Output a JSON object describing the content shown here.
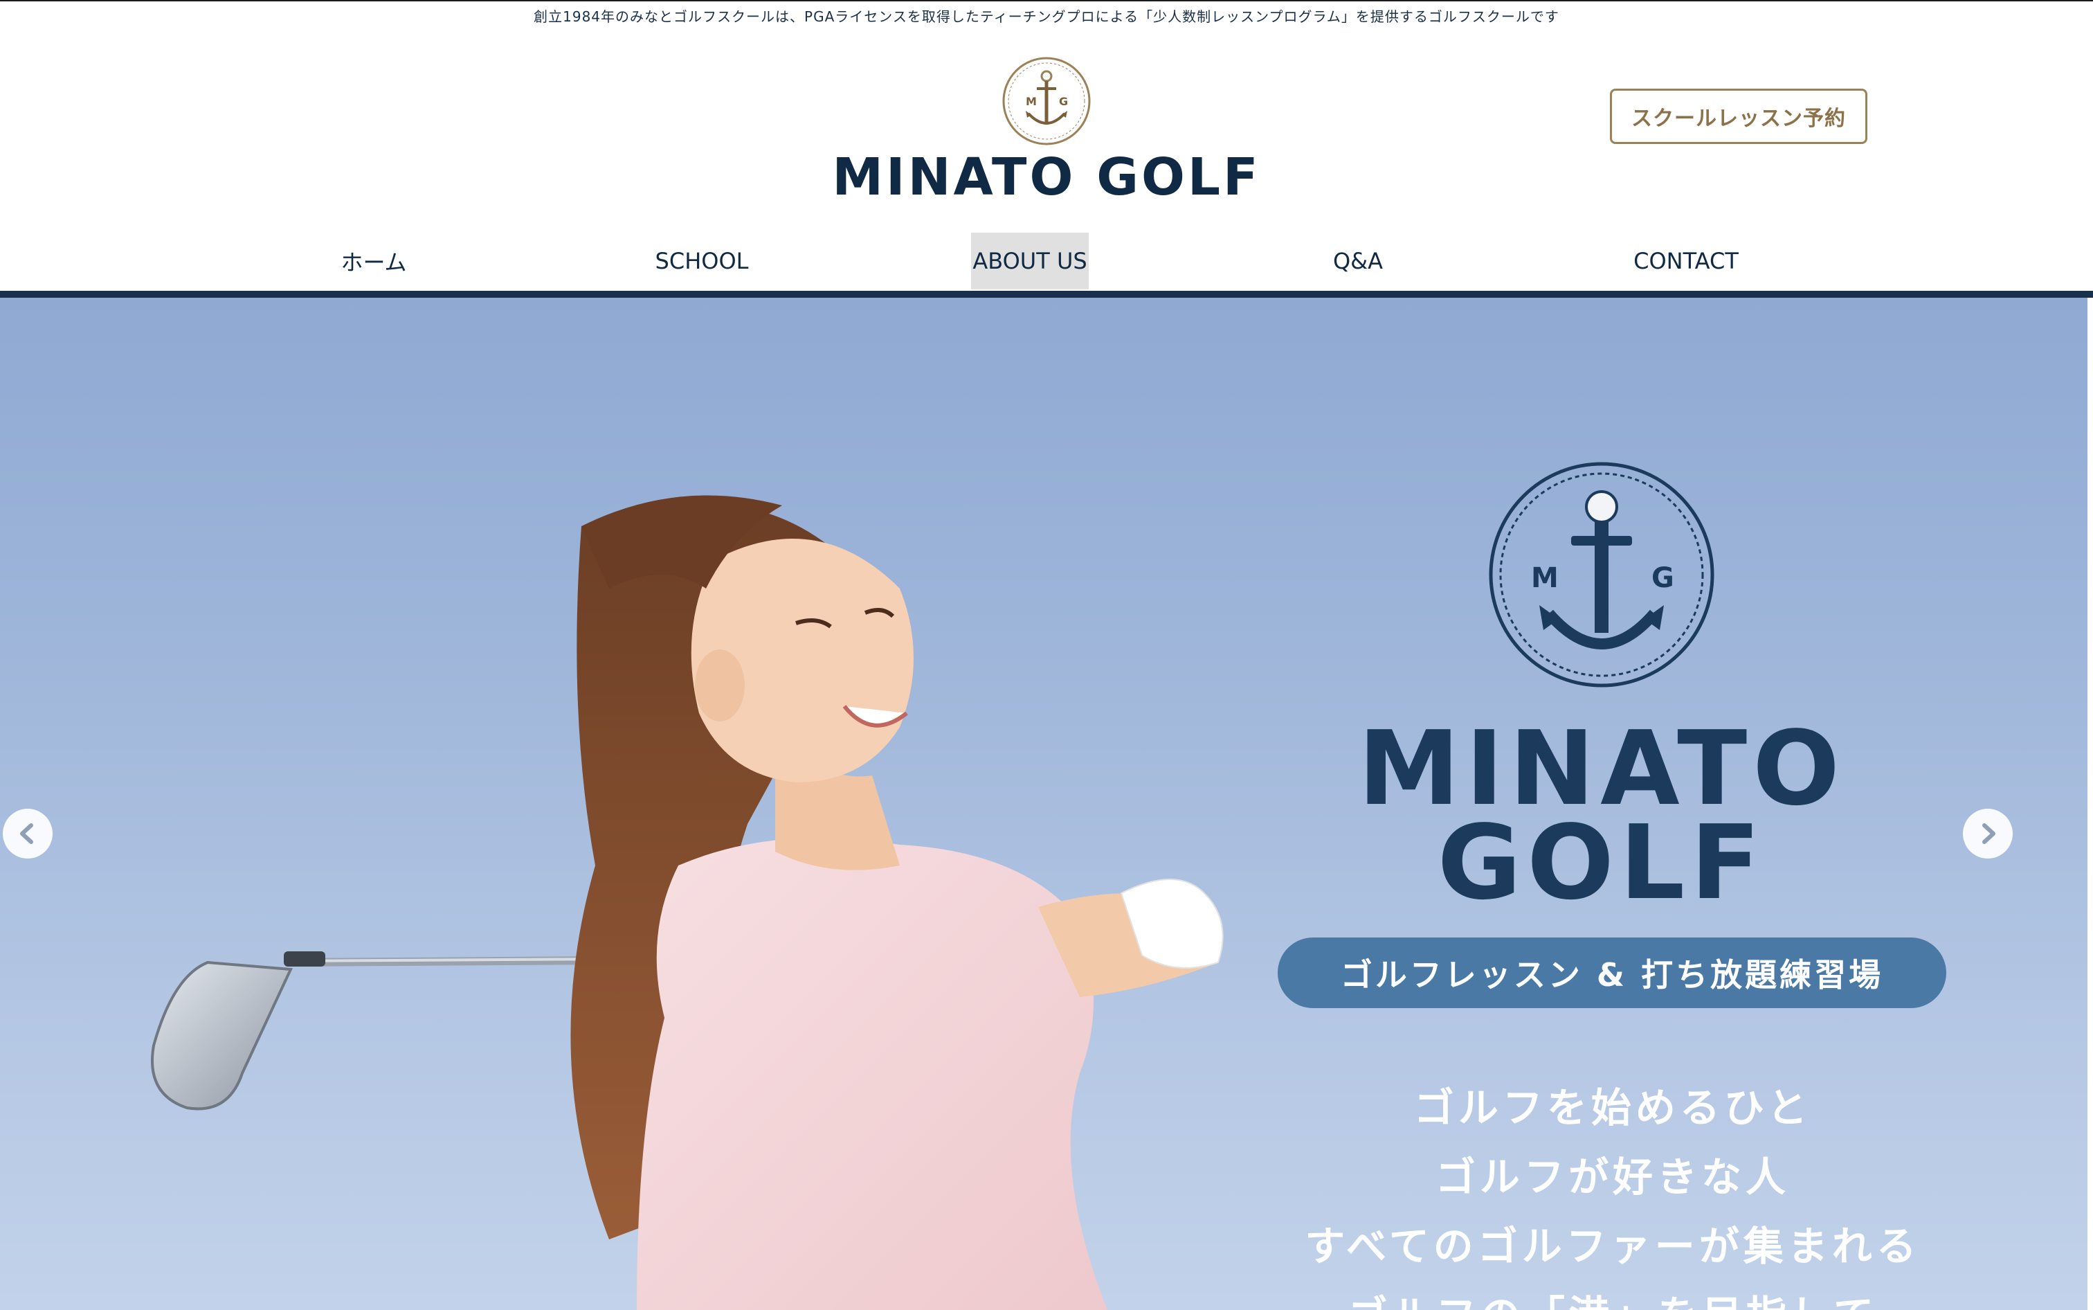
{
  "header": {
    "tagline": "創立1984年のみなとゴルフスクールは、PGAライセンスを取得したティーチングプロによる「少人数制レッスンプログラム」を提供するゴルフスクールです",
    "logo_text": "MINATO GOLF",
    "logo_letters": [
      "M",
      "G"
    ],
    "reserve_button": "スクールレッスン予約"
  },
  "nav": {
    "items": [
      {
        "label": "ホーム"
      },
      {
        "label": "SCHOOL"
      },
      {
        "label": "ABOUT US"
      },
      {
        "label": "Q&A"
      },
      {
        "label": "CONTACT"
      }
    ],
    "active_index": 2
  },
  "hero": {
    "brand_line1": "MINATO",
    "brand_line2": "GOLF",
    "emblem_letters": [
      "M",
      "G"
    ],
    "pill": "ゴルフレッスン & 打ち放題練習場",
    "lines": [
      "ゴルフを始めるひと",
      "ゴルフが好きな人",
      "すべてのゴルファーが集まれる",
      "ゴルフの「港」を目指して"
    ]
  },
  "colors": {
    "navy": "#102a45",
    "gold": "#9b8158",
    "pill_blue": "#4a79a6",
    "sky": "#9fb6da"
  },
  "icons": {
    "prev": "chevron-left-icon",
    "next": "chevron-right-icon",
    "emblem": "anchor-icon"
  }
}
